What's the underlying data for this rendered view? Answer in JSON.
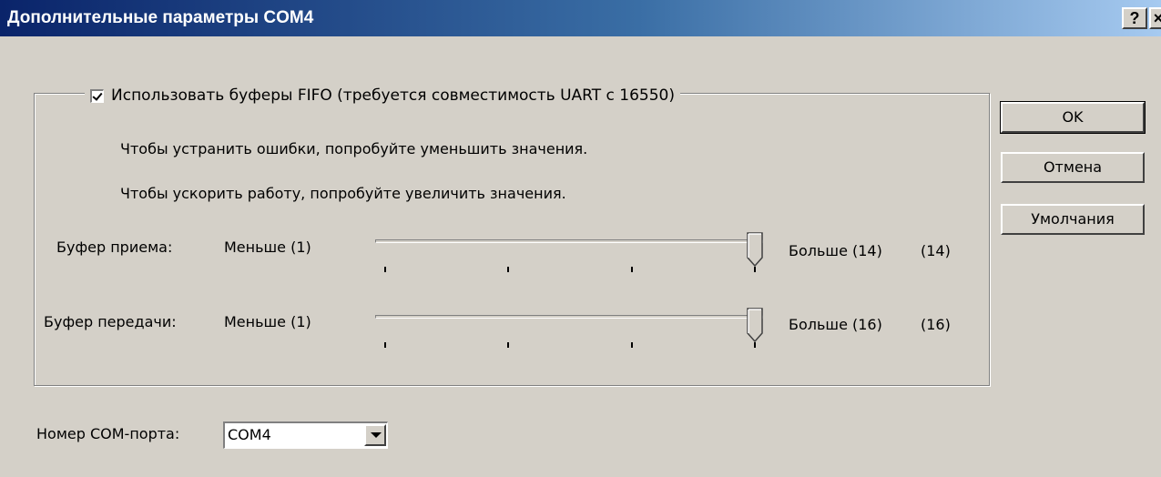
{
  "window": {
    "title": "Дополнительные параметры COM4",
    "help_glyph": "?",
    "close_glyph": "×"
  },
  "fifo": {
    "checked": true,
    "label": "Использовать буферы FIFO (требуется совместимость UART с 16550)",
    "hint_errors": "Чтобы устранить ошибки, попробуйте уменьшить значения.",
    "hint_speed": "Чтобы ускорить работу, попробуйте увеличить значения."
  },
  "receive": {
    "label": "Буфер приема:",
    "min_label": "Меньше (1)",
    "max_label": "Больше (14)",
    "value_label": "(14)",
    "value": 14,
    "min": 1,
    "max": 14
  },
  "transmit": {
    "label": "Буфер передачи:",
    "min_label": "Меньше (1)",
    "max_label": "Больше (16)",
    "value_label": "(16)",
    "value": 16,
    "min": 1,
    "max": 16
  },
  "buttons": {
    "ok": "OK",
    "cancel": "Отмена",
    "defaults": "Умолчания"
  },
  "port": {
    "label": "Номер COM-порта:",
    "selected": "COM4"
  },
  "colors": {
    "face": "#d4d0c8",
    "title_start": "#0a246a",
    "title_end": "#a6caf0"
  },
  "icons": {
    "help": "help-icon",
    "close": "close-icon",
    "check": "checkmark-icon",
    "dropdown": "chevron-down-icon"
  }
}
